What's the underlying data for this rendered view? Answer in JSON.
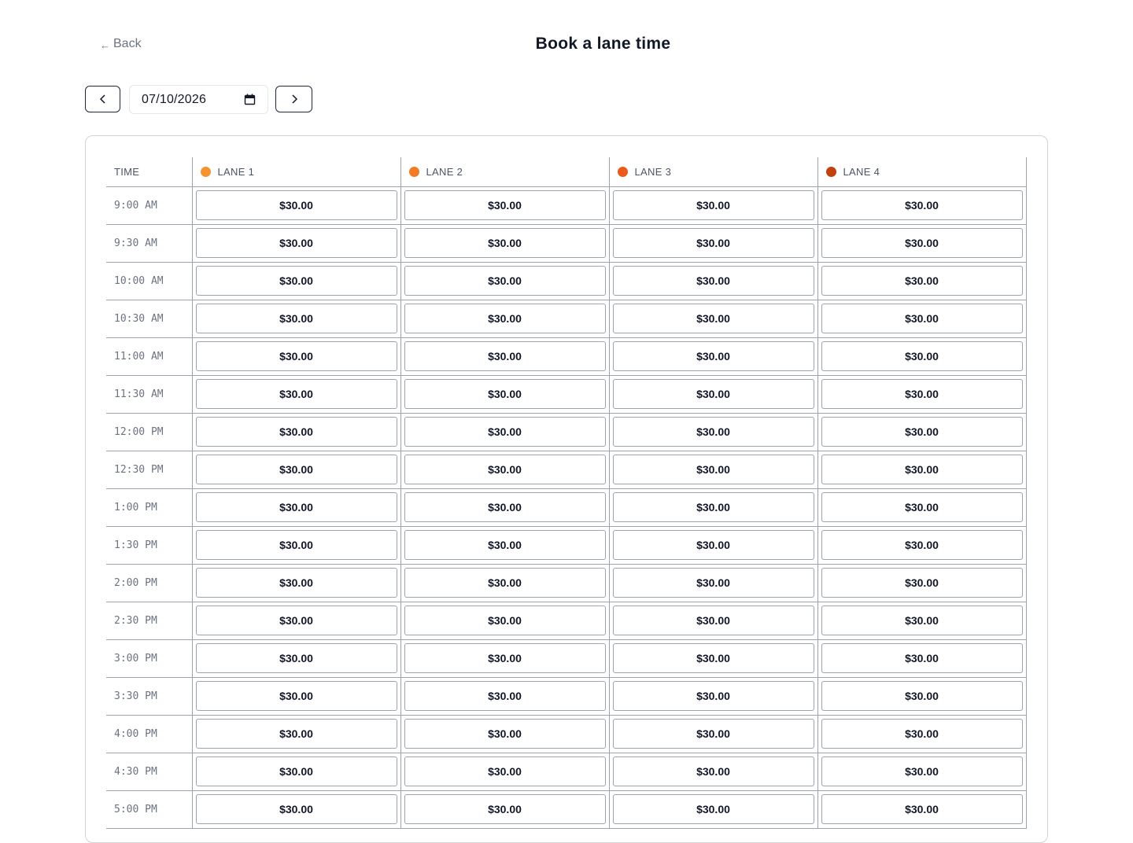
{
  "header": {
    "back_arrow": "←",
    "back_label": "Back",
    "title": "Book a lane time"
  },
  "date_nav": {
    "prev_icon": "chevron-left-icon",
    "next_icon": "chevron-right-icon",
    "date_value": "07/10/2026",
    "calendar_icon": "calendar-icon"
  },
  "schedule": {
    "time_header": "TIME",
    "lanes": [
      {
        "label": "LANE 1",
        "color": "#f59332"
      },
      {
        "label": "LANE 2",
        "color": "#f37a25"
      },
      {
        "label": "LANE 3",
        "color": "#e95a1b"
      },
      {
        "label": "LANE 4",
        "color": "#c2410c"
      }
    ],
    "rows": [
      {
        "time": "9:00 AM",
        "prices": [
          "$30.00",
          "$30.00",
          "$30.00",
          "$30.00"
        ]
      },
      {
        "time": "9:30 AM",
        "prices": [
          "$30.00",
          "$30.00",
          "$30.00",
          "$30.00"
        ]
      },
      {
        "time": "10:00 AM",
        "prices": [
          "$30.00",
          "$30.00",
          "$30.00",
          "$30.00"
        ]
      },
      {
        "time": "10:30 AM",
        "prices": [
          "$30.00",
          "$30.00",
          "$30.00",
          "$30.00"
        ]
      },
      {
        "time": "11:00 AM",
        "prices": [
          "$30.00",
          "$30.00",
          "$30.00",
          "$30.00"
        ]
      },
      {
        "time": "11:30 AM",
        "prices": [
          "$30.00",
          "$30.00",
          "$30.00",
          "$30.00"
        ]
      },
      {
        "time": "12:00 PM",
        "prices": [
          "$30.00",
          "$30.00",
          "$30.00",
          "$30.00"
        ]
      },
      {
        "time": "12:30 PM",
        "prices": [
          "$30.00",
          "$30.00",
          "$30.00",
          "$30.00"
        ]
      },
      {
        "time": "1:00 PM",
        "prices": [
          "$30.00",
          "$30.00",
          "$30.00",
          "$30.00"
        ]
      },
      {
        "time": "1:30 PM",
        "prices": [
          "$30.00",
          "$30.00",
          "$30.00",
          "$30.00"
        ]
      },
      {
        "time": "2:00 PM",
        "prices": [
          "$30.00",
          "$30.00",
          "$30.00",
          "$30.00"
        ]
      },
      {
        "time": "2:30 PM",
        "prices": [
          "$30.00",
          "$30.00",
          "$30.00",
          "$30.00"
        ]
      },
      {
        "time": "3:00 PM",
        "prices": [
          "$30.00",
          "$30.00",
          "$30.00",
          "$30.00"
        ]
      },
      {
        "time": "3:30 PM",
        "prices": [
          "$30.00",
          "$30.00",
          "$30.00",
          "$30.00"
        ]
      },
      {
        "time": "4:00 PM",
        "prices": [
          "$30.00",
          "$30.00",
          "$30.00",
          "$30.00"
        ]
      },
      {
        "time": "4:30 PM",
        "prices": [
          "$30.00",
          "$30.00",
          "$30.00",
          "$30.00"
        ]
      },
      {
        "time": "5:00 PM",
        "prices": [
          "$30.00",
          "$30.00",
          "$30.00",
          "$30.00"
        ]
      }
    ]
  }
}
